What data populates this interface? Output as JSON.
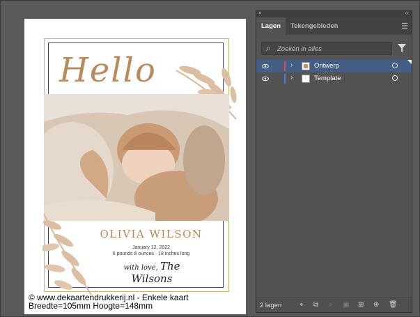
{
  "artboard": {
    "hello": "Hello",
    "name": "OLIVIA WILSON",
    "date": "January 12, 2022",
    "stats": "6 pounds 8 ounces · 18 inches long",
    "signature_small": "with love,",
    "signature_big": "The Wilsons"
  },
  "footer": {
    "line1": "© www.dekaartendrukkerij.nl - Enkele kaart",
    "line2": "Breedte=105mm Hoogte=148mm"
  },
  "panel": {
    "close": "×",
    "collapse": "‹‹",
    "tabs": [
      {
        "label": "Lagen",
        "active": true
      },
      {
        "label": "Tekengebieden",
        "active": false
      }
    ],
    "menu_icon": "☰",
    "search_placeholder": "Zoeken in alles",
    "layers": [
      {
        "name": "Ontwerp",
        "color": "#e8455a",
        "selected": true
      },
      {
        "name": "Template",
        "color": "#4f7be8",
        "selected": false
      }
    ],
    "count": "2 lagen",
    "bottom_icons": [
      "locate-object-icon",
      "release-clipping-icon",
      "search-layer-icon",
      "collect-export-icon",
      "new-sublayer-icon",
      "new-layer-icon",
      "delete-layer-icon"
    ]
  },
  "colors": {
    "accent_gold": "#c8b46a",
    "accent_blue": "#3b3f9a",
    "text_brown": "#b98a5c",
    "selection": "#445e85"
  }
}
